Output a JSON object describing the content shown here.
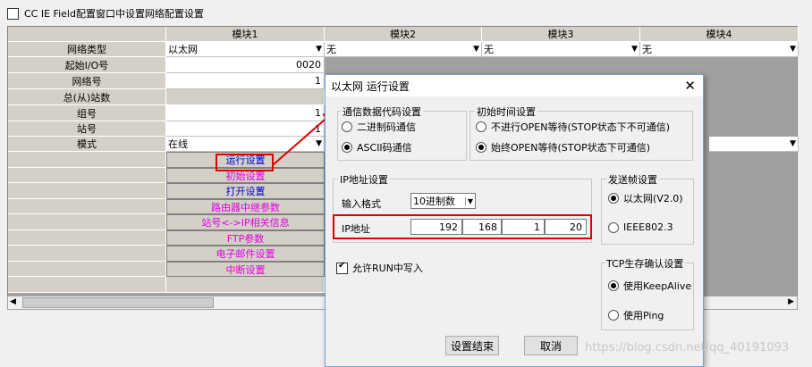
{
  "top_checkbox_label": "CC IE Field配置窗口中设置网络配置设置",
  "grid": {
    "headers": [
      "模块1",
      "模块2",
      "模块3",
      "模块4"
    ],
    "row_labels": [
      "网络类型",
      "起始I/O号",
      "网络号",
      "总(从)站数",
      "组号",
      "站号",
      "模式"
    ],
    "module1": {
      "network_type": "以太网",
      "io_start": "0020",
      "network_no": "1",
      "group_no": "1",
      "station_no": "1",
      "mode": "在线"
    },
    "module_other_network_type": "无",
    "buttons": [
      "运行设置",
      "初始设置",
      "打开设置",
      "路由器中继参数",
      "站号<->IP相关信息",
      "FTP参数",
      "电子邮件设置",
      "中断设置"
    ]
  },
  "dialog": {
    "title": "以太网 运行设置",
    "comm_code": {
      "label": "通信数据代码设置",
      "options": [
        "二进制码通信",
        "ASCII码通信"
      ],
      "selected": 1
    },
    "init_timing": {
      "label": "初始时间设置",
      "options": [
        "不进行OPEN等待(STOP状态下不可通信)",
        "始终OPEN等待(STOP状态下可通信)"
      ],
      "selected": 1
    },
    "ip_settings": {
      "label": "IP地址设置",
      "format_label": "输入格式",
      "format_value": "10进制数",
      "ip_label": "IP地址",
      "ip": [
        "192",
        "168",
        "1",
        "20"
      ]
    },
    "frame": {
      "label": "发送帧设置",
      "options": [
        "以太网(V2.0)",
        "IEEE802.3"
      ],
      "selected": 0
    },
    "allow_run_write": {
      "label": "允许RUN中写入",
      "checked": true
    },
    "tcp_keepalive": {
      "label": "TCP生存确认设置",
      "options": [
        "使用KeepAlive",
        "使用Ping"
      ],
      "selected": 0
    },
    "ok_label": "设置结束",
    "cancel_label": "取消"
  },
  "watermark": "https://blog.csdn.net/qq_40191093"
}
